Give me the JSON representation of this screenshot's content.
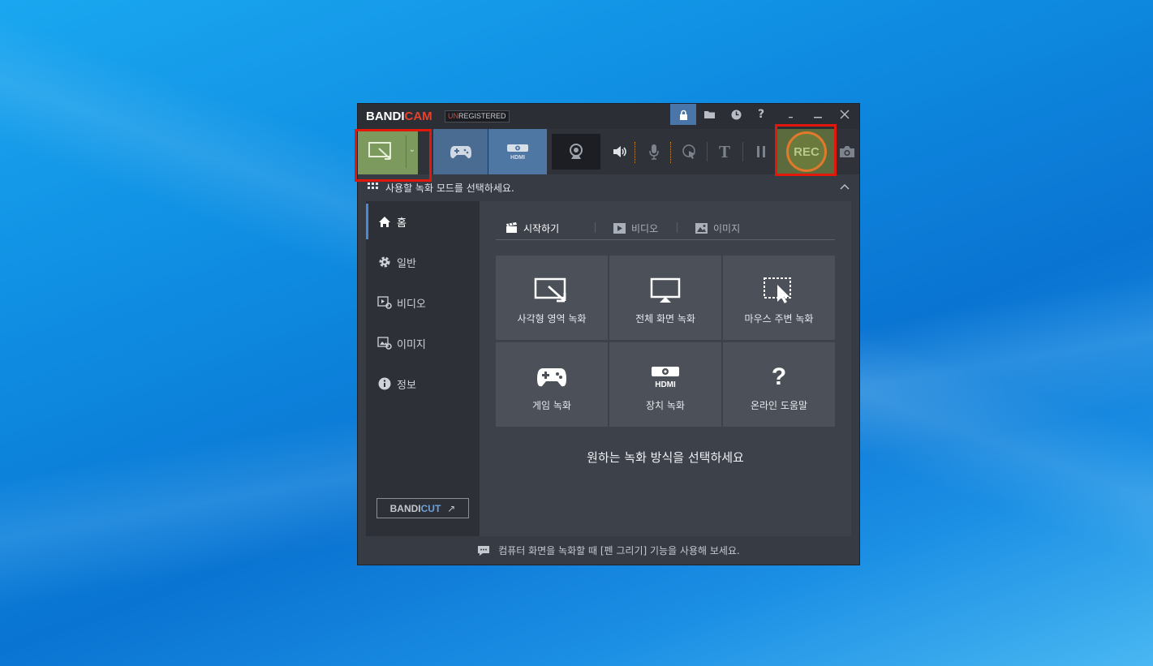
{
  "app": {
    "logo_prefix": "BANDI",
    "logo_suffix": "CAM",
    "badge_prefix": "UN",
    "badge_suffix": "REGISTERED"
  },
  "titlebar": {
    "buttons": [
      {
        "name": "lock-icon",
        "glyph": "🔒"
      },
      {
        "name": "folder-icon",
        "glyph": "📂"
      },
      {
        "name": "clock-icon",
        "glyph": "◷"
      },
      {
        "name": "help-icon",
        "glyph": "?"
      },
      {
        "name": "minimize-tray-icon",
        "glyph": "-"
      },
      {
        "name": "minimize-icon",
        "glyph": "–"
      },
      {
        "name": "close-icon",
        "glyph": "✕"
      }
    ]
  },
  "toolbar": {
    "rec_label": "REC",
    "text_tool_label": "T",
    "hdmi_label": "HDMI"
  },
  "modebar": {
    "text": "사용할 녹화 모드를 선택하세요."
  },
  "sidebar": {
    "items": [
      {
        "label": "홈",
        "icon": "home-icon"
      },
      {
        "label": "일반",
        "icon": "gear-icon"
      },
      {
        "label": "비디오",
        "icon": "video-settings-icon"
      },
      {
        "label": "이미지",
        "icon": "image-settings-icon"
      },
      {
        "label": "정보",
        "icon": "info-icon"
      }
    ],
    "bandicut_prefix": "BANDI",
    "bandicut_suffix": "CUT",
    "bandicut_arrow": "↗"
  },
  "main": {
    "tabs": [
      {
        "label": "시작하기",
        "icon": "clapper-icon"
      },
      {
        "label": "비디오",
        "icon": "video-icon"
      },
      {
        "label": "이미지",
        "icon": "image-icon"
      }
    ],
    "tiles": [
      {
        "label": "사각형 영역 녹화",
        "icon": "rectangle-area-icon"
      },
      {
        "label": "전체 화면 녹화",
        "icon": "fullscreen-monitor-icon"
      },
      {
        "label": "마우스 주변 녹화",
        "icon": "mouse-area-icon"
      },
      {
        "label": "게임 녹화",
        "icon": "gamepad-icon"
      },
      {
        "label": "장치 녹화",
        "icon": "hdmi-device-icon"
      },
      {
        "label": "온라인 도움말",
        "icon": "question-icon"
      }
    ],
    "message": "원하는 녹화 방식을 선택하세요"
  },
  "footer": {
    "tip": "컴퓨터 화면을 녹화할 때 [펜 그리기] 기능을 사용해 보세요."
  },
  "colors": {
    "rect_mode_active": "#7c9a5e",
    "game_mode": "#4a6c93",
    "hdmi_mode": "#4f77a3",
    "rec_ring": "#e07a2a",
    "highlight_box": "#e3170a",
    "brand_red": "#e8412c",
    "bandicut_blue": "#6fa1d9"
  }
}
